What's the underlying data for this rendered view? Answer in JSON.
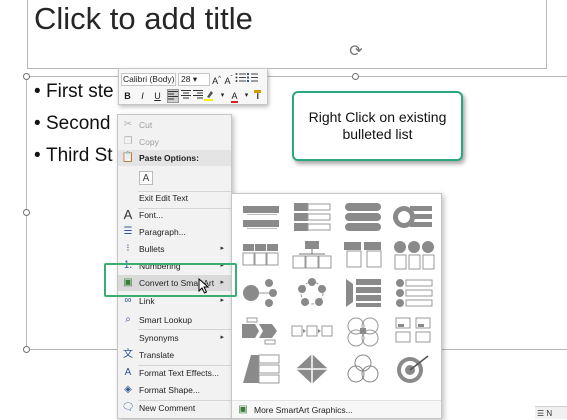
{
  "slide": {
    "title_placeholder": "Click to add title",
    "bullets": [
      "First ste",
      "Second",
      "Third St"
    ],
    "bullet_glyph": "•"
  },
  "mini_toolbar": {
    "font_name": "Calibri (Body)",
    "font_size": "28",
    "grow_font": "A",
    "shrink_font": "A",
    "bold": "B",
    "italic": "I",
    "underline": "U",
    "font_color": "A"
  },
  "context_menu": {
    "cut": "Cut",
    "copy": "Copy",
    "paste_options": "Paste Options:",
    "exit_edit_text": "Exit Edit Text",
    "font": "Font...",
    "paragraph": "Paragraph...",
    "bullets": "Bullets",
    "numbering": "Numbering",
    "convert_to_smartart": "Convert to SmartArt",
    "link": "Link",
    "smart_lookup": "Smart Lookup",
    "synonyms": "Synonyms",
    "translate": "Translate",
    "format_text_effects": "Format Text Effects...",
    "format_shape": "Format Shape...",
    "new_comment": "New Comment"
  },
  "smartart_menu": {
    "more_label": "More SmartArt Graphics..."
  },
  "callout": {
    "text": "Right Click on existing bulleted list"
  },
  "status_bar": {
    "text": "N"
  },
  "colors": {
    "highlight_outline": "#3aad73",
    "callout_border": "#2aa681",
    "smartart_shape": "#8a8a8a"
  }
}
